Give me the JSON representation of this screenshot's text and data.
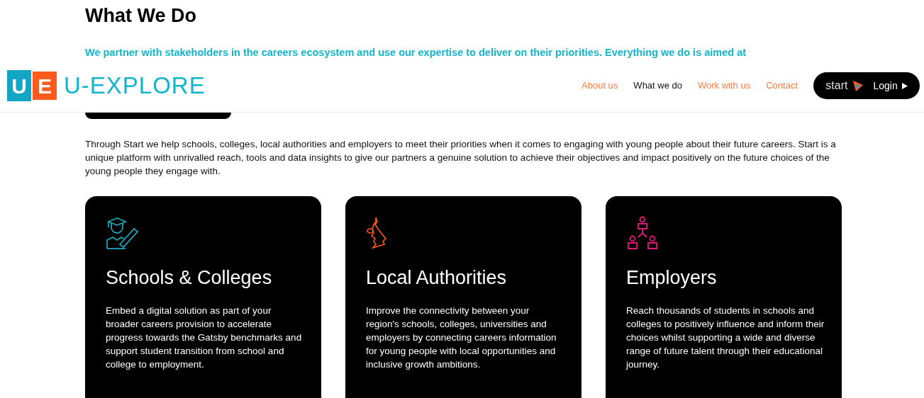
{
  "section": {
    "heading": "What We Do",
    "intro": "We partner with stakeholders in the careers ecosystem and use our expertise to deliver on their priorities. Everything we do is aimed at",
    "body": "Through Start we help schools, colleges, local authorities and employers to meet their priorities when it comes to engaging with young people about their future careers. Start is a unique platform with unrivalled reach, tools and data insights to give our partners a genuine solution to achieve their objectives and impact positively on the future choices of the young people they engage with."
  },
  "header": {
    "logo_letters": [
      "U",
      "E"
    ],
    "logo_text": "U-EXPLORE",
    "nav": [
      {
        "label": "About us",
        "selected": false
      },
      {
        "label": "What we do",
        "selected": true
      },
      {
        "label": "Work with us",
        "selected": false
      },
      {
        "label": "Contact",
        "selected": false
      }
    ],
    "login": {
      "brand": "start",
      "label": "Login"
    }
  },
  "cards": [
    {
      "kind": "graduate",
      "title": "Schools & Colleges",
      "text": "Embed a digital solution as part of your broader careers provision to accelerate progress towards the Gatsby benchmarks and support student transition from school and college to employment."
    },
    {
      "kind": "map",
      "title": "Local Authorities",
      "text": "Improve the connectivity between your region's schools, colleges, universities and employers by connecting careers information for young people with local opportunities and inclusive growth ambitions."
    },
    {
      "kind": "network",
      "title": "Employers",
      "text": "Reach thousands of students in schools and colleges to positively influence and inform their choices whilst supporting a wide and diverse range of future talent through their educational journey."
    }
  ]
}
